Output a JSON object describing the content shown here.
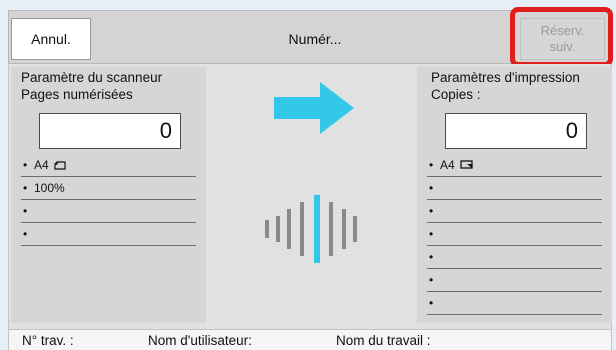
{
  "header": {
    "cancel_label": "Annul.",
    "title": "Numér...",
    "reserve_label": "Réserv.\nsuiv."
  },
  "scanner": {
    "title_line1": "Paramètre du scanneur",
    "title_line2": "Pages numérisées",
    "count": "0",
    "rows": [
      "A4",
      "100%",
      "",
      ""
    ]
  },
  "print": {
    "title_line1": "Paramètres d'impression",
    "title_line2": "Copies :",
    "count": "0",
    "rows": [
      "A4",
      "",
      "",
      "",
      "",
      "",
      ""
    ]
  },
  "icons": {
    "arrow": "right-arrow-icon",
    "activity": "scan-activity-icon",
    "arrow_color": "#33c8e8"
  },
  "footer": {
    "job_no_label": "N° trav. :",
    "user_name_label": "Nom d'utilisateur:",
    "job_name_label": "Nom du travail :"
  },
  "colors": {
    "highlight": "#e01e1e",
    "accent": "#33c8e8"
  }
}
